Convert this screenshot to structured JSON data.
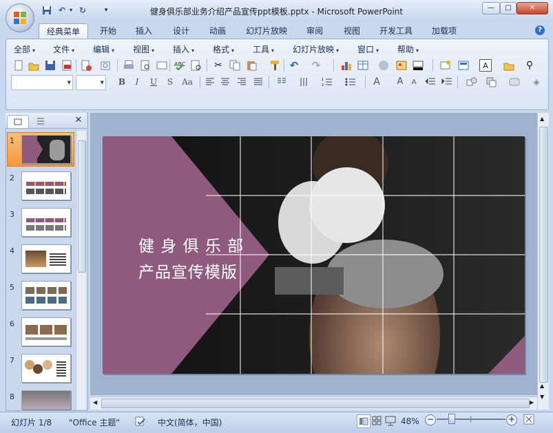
{
  "window": {
    "title": "健身俱乐部业务介绍产品宣传ppt模板.pptx - Microsoft PowerPoint",
    "minimize_glyph": "—",
    "maximize_glyph": "□",
    "close_glyph": "✕"
  },
  "tabs": [
    "经典菜单",
    "开始",
    "插入",
    "设计",
    "动画",
    "幻灯片放映",
    "审阅",
    "视图",
    "开发工具",
    "加载项"
  ],
  "help_glyph": "?",
  "menus": [
    "全部",
    "文件",
    "编辑",
    "视图",
    "插入",
    "格式",
    "工具",
    "幻灯片放映",
    "窗口",
    "帮助"
  ],
  "format_buttons": [
    "B",
    "I",
    "U",
    "S",
    "Aa"
  ],
  "left_panel": {
    "close_glyph": "✕",
    "slide_numbers": [
      "1",
      "2",
      "3",
      "4",
      "5",
      "6",
      "7",
      "8"
    ]
  },
  "slide": {
    "title_line1": "健 身 俱 乐 部",
    "title_line2": "产品宣传模版"
  },
  "status": {
    "slide_indicator": "幻灯片 1/8",
    "theme": "\"Office 主题\"",
    "language": "中文(简体，中国)",
    "zoom": "48%"
  },
  "colors": {
    "accent_purple": "#8e5b7f",
    "ribbon_bg": "#dbe6f5"
  }
}
